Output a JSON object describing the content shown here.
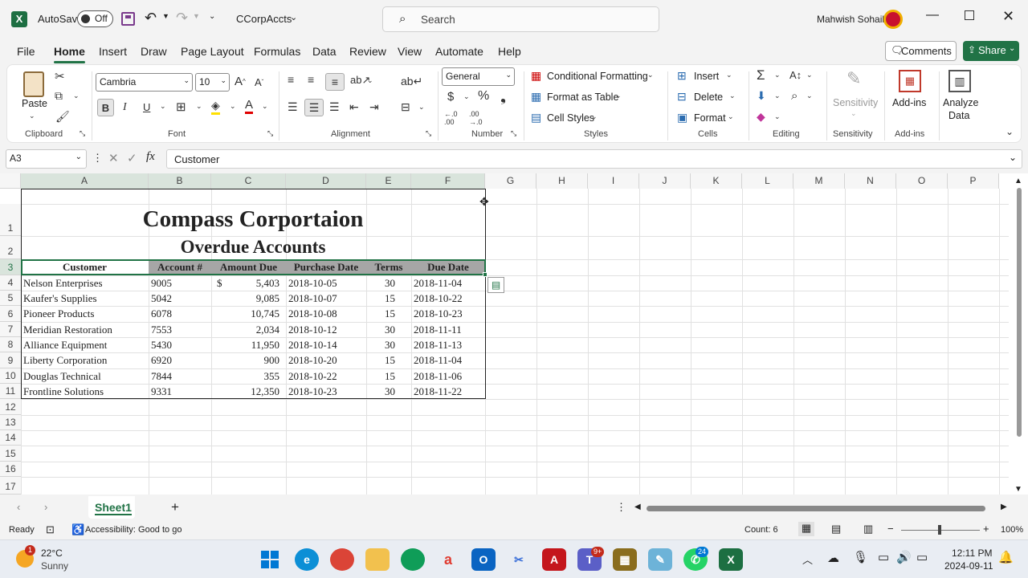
{
  "app": {
    "autosave_label": "AutoSave",
    "autosave_state": "Off",
    "file_name": "CCorpAccts",
    "search_placeholder": "Search",
    "user_name": "Mahwish Sohail"
  },
  "menu": [
    "File",
    "Home",
    "Insert",
    "Draw",
    "Page Layout",
    "Formulas",
    "Data",
    "Review",
    "View",
    "Automate",
    "Help"
  ],
  "comments_label": "Comments",
  "share_label": "Share",
  "ribbon": {
    "paste": "Paste",
    "clipboard": "Clipboard",
    "font_name": "Cambria",
    "font_size": "10",
    "font": "Font",
    "alignment": "Alignment",
    "number_format": "General",
    "number": "Number",
    "cond_fmt": "Conditional Formatting",
    "fmt_table": "Format as Table",
    "cell_styles": "Cell Styles",
    "styles": "Styles",
    "insert": "Insert",
    "delete": "Delete",
    "format": "Format",
    "cells": "Cells",
    "editing": "Editing",
    "sensitivity": "Sensitivity",
    "sensitivity_group": "Sensitivity",
    "addins": "Add-ins",
    "addins_group": "Add-ins",
    "analyze": "Analyze",
    "analyze2": "Data"
  },
  "namebox": "A3",
  "formula": "Customer",
  "columns": [
    "A",
    "B",
    "C",
    "D",
    "E",
    "F",
    "G",
    "H",
    "I",
    "J",
    "K",
    "L",
    "M",
    "N",
    "O",
    "P"
  ],
  "rows": [
    "1",
    "2",
    "3",
    "4",
    "5",
    "6",
    "7",
    "8",
    "9",
    "10",
    "11",
    "12",
    "13",
    "14",
    "15",
    "16",
    "17"
  ],
  "sheet": {
    "title": "Compass Corportaion",
    "subtitle": "Overdue Accounts",
    "headers": [
      "Customer",
      "Account #",
      "Amount Due",
      "Purchase Date",
      "Terms",
      "Due Date"
    ],
    "data": [
      [
        "Nelson Enterprises",
        "9005",
        "5,403",
        "2018-10-05",
        "30",
        "2018-11-04"
      ],
      [
        "Kaufer's Supplies",
        "5042",
        "9,085",
        "2018-10-07",
        "15",
        "2018-10-22"
      ],
      [
        "Pioneer Products",
        "6078",
        "10,745",
        "2018-10-08",
        "15",
        "2018-10-23"
      ],
      [
        "Meridian Restoration",
        "7553",
        "2,034",
        "2018-10-12",
        "30",
        "2018-11-11"
      ],
      [
        "Alliance Equipment",
        "5430",
        "11,950",
        "2018-10-14",
        "30",
        "2018-11-13"
      ],
      [
        "Liberty Corporation",
        "6920",
        "900",
        "2018-10-20",
        "15",
        "2018-11-04"
      ],
      [
        "Douglas Technical",
        "7844",
        "355",
        "2018-10-22",
        "15",
        "2018-11-06"
      ],
      [
        "Frontline Solutions",
        "9331",
        "12,350",
        "2018-10-23",
        "30",
        "2018-11-22"
      ]
    ],
    "currency": "$"
  },
  "sheet_tab": "Sheet1",
  "status": {
    "ready": "Ready",
    "accessibility": "Accessibility: Good to go",
    "count": "Count: 6",
    "zoom": "100%"
  },
  "taskbar": {
    "temp": "22°C",
    "weather": "Sunny",
    "time": "12:11 PM",
    "date": "2024-09-11",
    "badge_weather": "1",
    "badge_teams": "9+",
    "badge_whatsapp": "24"
  },
  "colors": {
    "accent": "#217346",
    "header_fill": "#a6a6a6"
  }
}
